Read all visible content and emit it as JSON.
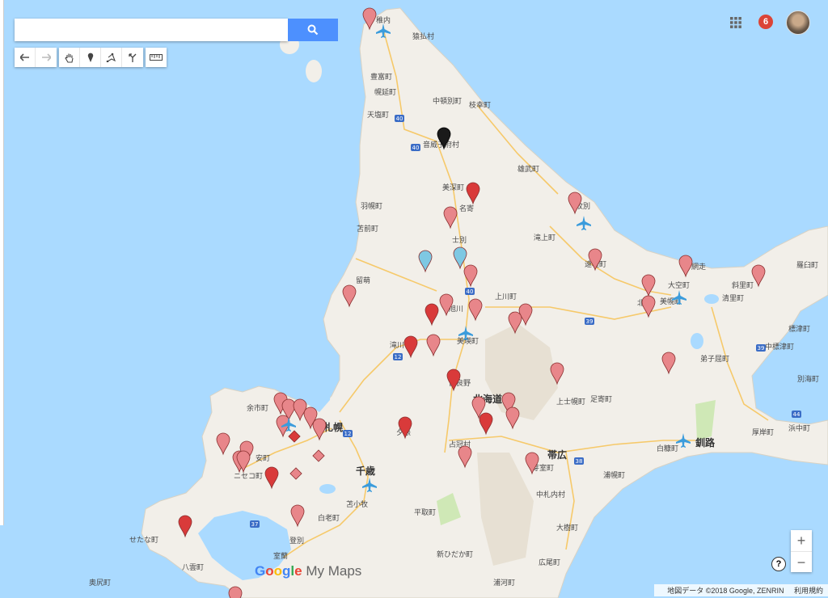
{
  "search": {
    "placeholder": "",
    "button_icon": "search-icon"
  },
  "toolbar": {
    "history": [
      "undo-icon",
      "redo-icon"
    ],
    "tools": [
      "hand-icon",
      "marker-icon",
      "polygon-icon",
      "route-icon"
    ],
    "measure": [
      "ruler-icon"
    ]
  },
  "account": {
    "notification_count": "6"
  },
  "zoom": {
    "in": "+",
    "out": "−"
  },
  "help_label": "?",
  "brand": {
    "google": "Google",
    "product": "My Maps"
  },
  "attribution": {
    "data": "地図データ ©2018 Google, ZENRIN",
    "terms": "利用規約"
  },
  "place_labels": {
    "稚内": "稚内",
    "猿払村": "猿払村",
    "豊富町": "豊富町",
    "幌延町": "幌延町",
    "中頓別町": "中頓別町",
    "枝幸町": "枝幸町",
    "天塩町": "天塩町",
    "音威子府村": "音威子府村",
    "雄武町": "雄武町",
    "美深町": "美深町",
    "名寄": "名寄",
    "羽幌町": "羽幌町",
    "苫前町": "苫前町",
    "士別": "士別",
    "紋別": "紋別",
    "滝上町": "滝上町",
    "留萌": "留萌",
    "旭川": "旭川",
    "上川町": "上川町",
    "遠軽町": "遠軽町",
    "網走": "網走",
    "大空町": "大空町",
    "美幌町": "美幌町",
    "北見": "北見",
    "清里町": "清里町",
    "羅臼町": "羅臼町",
    "斜里町": "斜里町",
    "標津町": "標津町",
    "中標津町": "中標津町",
    "弟子屈町": "弟子屈町",
    "別海町": "別海町",
    "滝川": "滝川",
    "美瑛町": "美瑛町",
    "富良野": "富良野",
    "北海道": "北海道",
    "上士幌町": "上士幌町",
    "足寄町": "足寄町",
    "浜中町": "浜中町",
    "厚岸町": "厚岸町",
    "白糠町": "白糠町",
    "釧路": "釧路",
    "余市町": "余市町",
    "札幌": "札幌",
    "夕張": "夕張",
    "占冠村": "占冠村",
    "帯広": "帯広",
    "芽室町": "芽室町",
    "浦幌町": "浦幌町",
    "安町": "安町",
    "ニセコ町": "ニセコ町",
    "千歳": "千歳",
    "苫小牧": "苫小牧",
    "中札内村": "中札内村",
    "白老町": "白老町",
    "平取町": "平取町",
    "大樹町": "大樹町",
    "登別": "登別",
    "室蘭": "室蘭",
    "新ひだか町": "新ひだか町",
    "せたな町": "せたな町",
    "八雲町": "八雲町",
    "広尾町": "広尾町",
    "奥尻町": "奥尻町",
    "浦河町": "浦河町"
  },
  "road_shields": [
    "40",
    "40",
    "40",
    "12",
    "12",
    "38",
    "39",
    "39",
    "44",
    "37"
  ],
  "colors": {
    "sea": "#aadaff",
    "land": "#f2efe9",
    "pin_light": "#e8868a",
    "pin_red": "#d93a3a",
    "pin_blue": "#7ec8e3",
    "pin_black": "#1a1a1a",
    "airport": "#3b9cdc"
  },
  "markers": {
    "pins": [
      {
        "color": "light"
      },
      {
        "color": "black"
      },
      {
        "color": "red"
      },
      {
        "color": "light"
      },
      {
        "color": "light"
      },
      {
        "color": "blue"
      },
      {
        "color": "blue"
      },
      {
        "color": "light"
      },
      {
        "color": "light"
      },
      {
        "color": "light"
      },
      {
        "color": "light"
      },
      {
        "color": "light"
      },
      {
        "color": "light"
      },
      {
        "color": "light"
      },
      {
        "color": "red"
      },
      {
        "color": "light"
      },
      {
        "color": "light"
      },
      {
        "color": "light"
      },
      {
        "color": "light"
      },
      {
        "color": "red"
      },
      {
        "color": "light"
      },
      {
        "color": "red"
      },
      {
        "color": "light"
      },
      {
        "color": "light"
      },
      {
        "color": "light"
      },
      {
        "color": "light"
      },
      {
        "color": "light"
      },
      {
        "color": "light"
      },
      {
        "color": "light"
      },
      {
        "color": "light"
      },
      {
        "color": "red"
      },
      {
        "color": "light"
      },
      {
        "color": "light"
      },
      {
        "color": "red"
      },
      {
        "color": "light"
      },
      {
        "color": "light"
      },
      {
        "color": "light"
      },
      {
        "color": "light"
      },
      {
        "color": "light"
      },
      {
        "color": "red"
      },
      {
        "color": "light"
      },
      {
        "color": "light"
      },
      {
        "color": "red"
      },
      {
        "color": "light"
      },
      {
        "color": "light"
      }
    ],
    "airports": 7,
    "diamonds": [
      {
        "color": "red"
      },
      {
        "color": "light"
      },
      {
        "color": "light"
      }
    ]
  }
}
